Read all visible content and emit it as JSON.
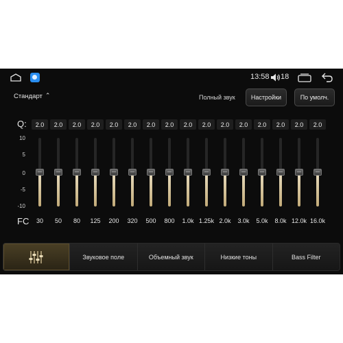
{
  "status_bar": {
    "time": "13:58",
    "volume_level": "18",
    "icons": [
      "home-icon",
      "app-icon",
      "volume-icon",
      "recent-apps-icon",
      "back-icon"
    ]
  },
  "controls": {
    "preset_label": "Стандарт",
    "preset_icon": "chevron-up-icon",
    "full_sound_label": "Полный звук",
    "settings_label": "Настройки",
    "default_label": "По умолч."
  },
  "equalizer": {
    "q_label": "Q:",
    "fc_label": "FC",
    "scale": [
      "10",
      "5",
      "0",
      "-5",
      "-10"
    ],
    "bands": [
      {
        "q": "2.0",
        "freq": "30",
        "gain": 0
      },
      {
        "q": "2.0",
        "freq": "50",
        "gain": 0
      },
      {
        "q": "2.0",
        "freq": "80",
        "gain": 0
      },
      {
        "q": "2.0",
        "freq": "125",
        "gain": 0
      },
      {
        "q": "2.0",
        "freq": "200",
        "gain": 0
      },
      {
        "q": "2.0",
        "freq": "320",
        "gain": 0
      },
      {
        "q": "2.0",
        "freq": "500",
        "gain": 0
      },
      {
        "q": "2.0",
        "freq": "800",
        "gain": 0
      },
      {
        "q": "2.0",
        "freq": "1.0k",
        "gain": 0
      },
      {
        "q": "2.0",
        "freq": "1.25k",
        "gain": 0
      },
      {
        "q": "2.0",
        "freq": "2.0k",
        "gain": 0
      },
      {
        "q": "2.0",
        "freq": "3.0k",
        "gain": 0
      },
      {
        "q": "2.0",
        "freq": "5.0k",
        "gain": 0
      },
      {
        "q": "2.0",
        "freq": "8.0k",
        "gain": 0
      },
      {
        "q": "2.0",
        "freq": "12.0k",
        "gain": 0
      },
      {
        "q": "2.0",
        "freq": "16.0k",
        "gain": 0
      }
    ]
  },
  "tabs": {
    "equalizer_icon": "equalizer-sliders-icon",
    "items": [
      "Звуковое поле",
      "Объемный звук",
      "Низкие тоны",
      "Bass Filter"
    ]
  },
  "colors": {
    "accent": "#d9c79a",
    "active_tab": "#4a3f25"
  }
}
